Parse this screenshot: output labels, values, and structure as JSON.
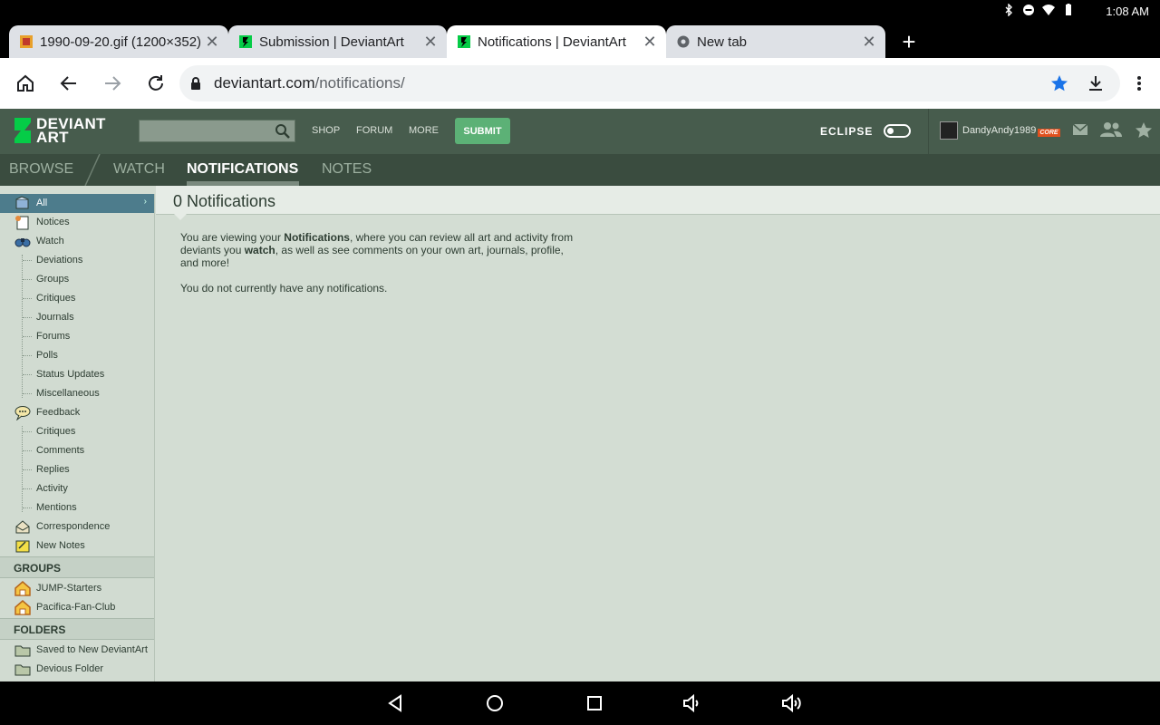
{
  "status_bar": {
    "time": "1:08 AM",
    "icons": [
      "bluetooth-icon",
      "dnd-icon",
      "wifi-icon",
      "battery-icon"
    ]
  },
  "tabs": [
    {
      "title": "1990-09-20.gif (1200×352)",
      "favicon": "image-icon"
    },
    {
      "title": "Submission | DeviantArt",
      "favicon": "deviantart-icon"
    },
    {
      "title": "Notifications | DeviantArt",
      "favicon": "deviantart-icon",
      "active": true
    },
    {
      "title": "New tab",
      "favicon": "chrome-icon"
    }
  ],
  "omnibox": {
    "host": "deviantart.com",
    "path": "/notifications/"
  },
  "da_header": {
    "logo_line1": "DEVIANT",
    "logo_line2": "ART",
    "nav": [
      "SHOP",
      "FORUM",
      "MORE"
    ],
    "submit": "SUBMIT",
    "eclipse": "ECLIPSE",
    "username": "DandyAndy1989",
    "badge": "CORE"
  },
  "subnav": {
    "browse": "BROWSE",
    "watch": "WATCH",
    "notifications": "NOTIFICATIONS",
    "notes": "NOTES"
  },
  "sidebar": {
    "items": [
      {
        "label": "All",
        "icon": "mailbox-icon"
      },
      {
        "label": "Notices",
        "icon": "notice-icon"
      },
      {
        "label": "Watch",
        "icon": "binoculars-icon"
      },
      {
        "label": "Deviations"
      },
      {
        "label": "Groups"
      },
      {
        "label": "Critiques"
      },
      {
        "label": "Journals"
      },
      {
        "label": "Forums"
      },
      {
        "label": "Polls"
      },
      {
        "label": "Status Updates"
      },
      {
        "label": "Miscellaneous"
      },
      {
        "label": "Feedback",
        "icon": "speech-bubble-icon"
      },
      {
        "label": "Critiques"
      },
      {
        "label": "Comments"
      },
      {
        "label": "Replies"
      },
      {
        "label": "Activity"
      },
      {
        "label": "Mentions"
      },
      {
        "label": "Correspondence",
        "icon": "correspondence-icon"
      },
      {
        "label": "New Notes",
        "icon": "note-icon"
      }
    ],
    "groups_heading": "GROUPS",
    "groups": [
      "JUMP-Starters",
      "Pacifica-Fan-Club"
    ],
    "folders_heading": "FOLDERS",
    "folders": [
      "Saved to New DeviantArt",
      "Devious Folder"
    ]
  },
  "main": {
    "title": "0 Notifications",
    "intro_1": "You are viewing your ",
    "intro_b1": "Notifications",
    "intro_2": ", where you can review all art and activity from deviants you ",
    "intro_b2": "watch",
    "intro_3": ", as well as see comments on your own art, journals, profile, and more!",
    "empty": "You do not currently have any notifications."
  },
  "colors": {
    "da_header": "#475c4d",
    "da_subnav": "#3a4c3f",
    "page_bg": "#d3ddd3",
    "submit": "#5cb176",
    "selected": "#4d7c8c"
  }
}
